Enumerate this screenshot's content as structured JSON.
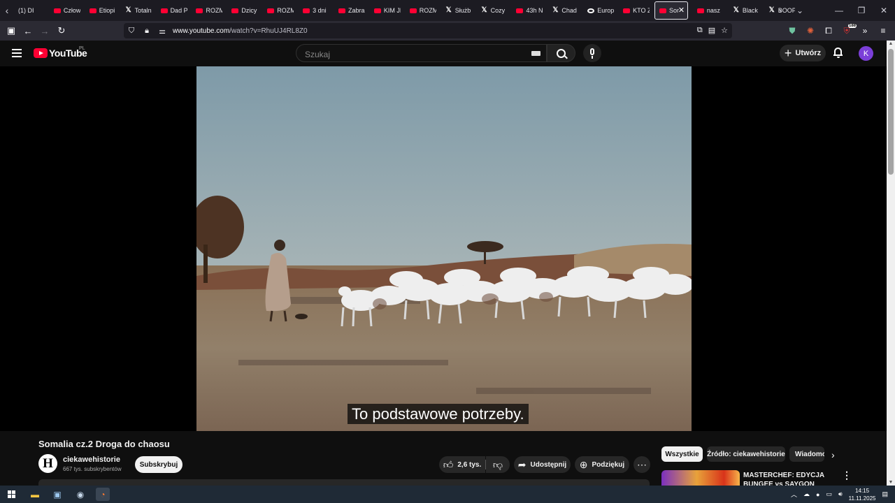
{
  "browser": {
    "tabs": [
      {
        "label": "(1) DI",
        "fav": "none"
      },
      {
        "label": "Człow",
        "fav": "youtube"
      },
      {
        "label": "Etiopi",
        "fav": "youtube"
      },
      {
        "label": "Totaln",
        "fav": "x"
      },
      {
        "label": "Dad P",
        "fav": "youtube"
      },
      {
        "label": "ROZM",
        "fav": "youtube"
      },
      {
        "label": "Dzicy",
        "fav": "youtube"
      },
      {
        "label": "ROZM",
        "fav": "youtube"
      },
      {
        "label": "3 dni",
        "fav": "youtube"
      },
      {
        "label": "Zabra",
        "fav": "youtube"
      },
      {
        "label": "KIM JE",
        "fav": "youtube"
      },
      {
        "label": "ROZM",
        "fav": "youtube"
      },
      {
        "label": "Służb",
        "fav": "x"
      },
      {
        "label": "Cozy",
        "fav": "x"
      },
      {
        "label": "43h N",
        "fav": "youtube"
      },
      {
        "label": "Chad",
        "fav": "x"
      },
      {
        "label": "Europ",
        "fav": "misc"
      },
      {
        "label": "KTO Z",
        "fav": "youtube"
      },
      {
        "label": "Sor",
        "fav": "youtube",
        "active": true
      },
      {
        "label": "nasz",
        "fav": "youtube"
      },
      {
        "label": "Black",
        "fav": "x"
      },
      {
        "label": "BOOP",
        "fav": "x"
      }
    ],
    "url_host": "www.youtube.com",
    "url_path": "/watch?v=RhuUJ4RL8Z0",
    "extensions_badge": "188"
  },
  "youtube": {
    "logo_text": "YouTube",
    "country_code": "PL",
    "search_placeholder": "Szukaj",
    "create_label": "Utwórz",
    "avatar_letter": "K"
  },
  "video": {
    "subtitle": "To podstawowe potrzeby.",
    "title": "Somalia cz.2 Droga do chaosu",
    "channel_initial": "H",
    "channel_name": "ciekawehistorie",
    "subscribers": "667 tys. subskrybentów",
    "subscribe_label": "Subskrybuj",
    "likes": "2,6 tys.",
    "share_label": "Udostępnij",
    "thanks_label": "Podziękuj"
  },
  "sidebar": {
    "chips": [
      "Wszystkie",
      "Źródło: ciekawehistorie",
      "Wiadomo"
    ],
    "recommendation_title": "MASTERCHEF: EDYCJA BUNGEE vs SAYGON"
  },
  "taskbar": {
    "time": "14:15",
    "date": "11.11.2025"
  },
  "colors": {
    "accent_red": "#ff0033",
    "background": "#0f0f0f",
    "avatar": "#7b3fd8"
  }
}
